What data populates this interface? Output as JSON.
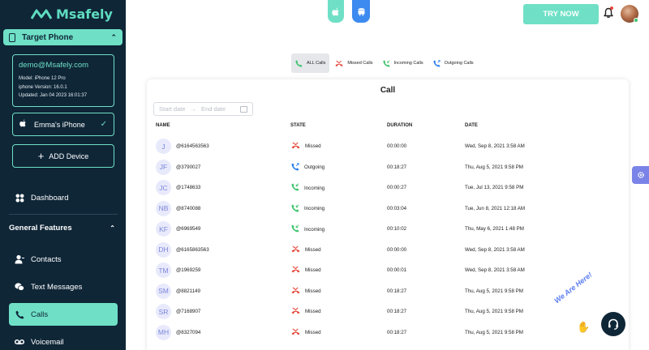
{
  "brand": {
    "name": "Msafely"
  },
  "sidebar": {
    "target_phone_label": "Target Phone",
    "device": {
      "email": "demo@Msafely.com",
      "model": "Model: iPhone 12 Pro",
      "version": "iphone Version: 16.0.1",
      "updated": "Updated: Jan 04 2023 16:01:37"
    },
    "selected_device": "Emma's iPhone",
    "add_device_label": "ADD Device",
    "dashboard_label": "Dashboard",
    "section_label": "General Features",
    "items": [
      {
        "label": "Contacts",
        "icon": "contacts-icon"
      },
      {
        "label": "Text Messages",
        "icon": "chat-icon"
      },
      {
        "label": "Calls",
        "icon": "phone-icon",
        "active": true
      },
      {
        "label": "Voicemail",
        "icon": "voicemail-icon"
      }
    ]
  },
  "header": {
    "try_now_label": "TRY NOW",
    "platforms": [
      "apple-icon",
      "android-icon"
    ]
  },
  "tabs": [
    {
      "label": "ALL Calls",
      "icon": "phone-icon",
      "active": true
    },
    {
      "label": "Missed Calls",
      "icon": "missed-call-icon"
    },
    {
      "label": "Incoming Calls",
      "icon": "incoming-call-icon"
    },
    {
      "label": "Outgoing Calls",
      "icon": "outgoing-call-icon"
    }
  ],
  "call_card": {
    "title": "Call",
    "start_placeholder": "Start date",
    "end_placeholder": "End date",
    "columns": [
      "NAME",
      "STATE",
      "DURATION",
      "DATE"
    ],
    "rows": [
      {
        "initials": "J",
        "number": "@6164563563",
        "state": "Missed",
        "duration": "00:00:00",
        "date": "Wed, Sep 8, 2021 3:58 AM"
      },
      {
        "initials": "JF",
        "number": "@3790027",
        "state": "Outgoing",
        "duration": "00:18:27",
        "date": "Thu, Aug 5, 2021 9:58 PM"
      },
      {
        "initials": "JC",
        "number": "@1748633",
        "state": "Incoming",
        "duration": "00:00:27",
        "date": "Tue, Jul 13, 2021 9:58 PM"
      },
      {
        "initials": "NB",
        "number": "@8740088",
        "state": "Incoming",
        "duration": "00:03:04",
        "date": "Tue, Jun 8, 2021 12:18 AM"
      },
      {
        "initials": "KF",
        "number": "@6969549",
        "state": "Incoming",
        "duration": "00:10:02",
        "date": "Thu, May 6, 2021 1:48 PM"
      },
      {
        "initials": "DH",
        "number": "@6165863563",
        "state": "Missed",
        "duration": "00:00:00",
        "date": "Wed, Sep 8, 2021 3:58 AM"
      },
      {
        "initials": "TM",
        "number": "@1969259",
        "state": "Missed",
        "duration": "00:00:01",
        "date": "Wed, Sep 8, 2021 3:58 AM"
      },
      {
        "initials": "SM",
        "number": "@8821149",
        "state": "Missed",
        "duration": "00:18:27",
        "date": "Thu, Aug 5, 2021 9:58 PM"
      },
      {
        "initials": "SR",
        "number": "@7168907",
        "state": "Missed",
        "duration": "00:18:27",
        "date": "Thu, Aug 5, 2021 9:58 PM"
      },
      {
        "initials": "MH",
        "number": "@8327094",
        "state": "Missed",
        "duration": "00:18:27",
        "date": "Thu, Aug 5, 2021 9:58 PM"
      }
    ]
  },
  "chat_widget": {
    "label": "We Are Here!"
  },
  "colors": {
    "accent": "#6fe0c6",
    "sidebar": "#0f2637",
    "missed": "#e6473a",
    "outgoing": "#2f80ed",
    "incoming": "#3ec46d"
  }
}
